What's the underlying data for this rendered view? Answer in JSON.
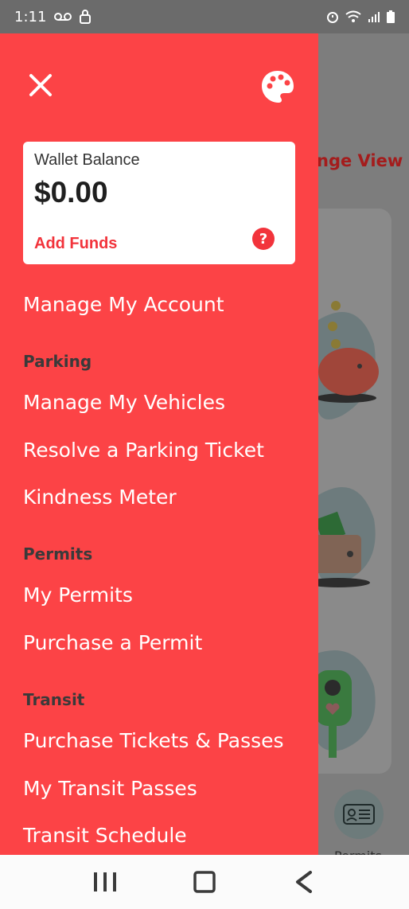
{
  "status_bar": {
    "time": "1:11",
    "icons_left": [
      "voicemail-icon",
      "lock-icon"
    ],
    "icons_right": [
      "alarm-icon",
      "wifi-icon",
      "signal-icon",
      "battery-icon"
    ]
  },
  "background": {
    "change_view_text": "nge View",
    "permits_label": "Permits"
  },
  "drawer": {
    "close_icon": "close-icon",
    "palette_icon": "palette-icon",
    "wallet": {
      "title": "Wallet Balance",
      "amount": "$0.00",
      "add_funds": "Add Funds",
      "help": "?"
    },
    "manage_account": "Manage My Account",
    "sections": [
      {
        "header": "Parking",
        "items": [
          "Manage My Vehicles",
          "Resolve a Parking Ticket",
          "Kindness Meter"
        ]
      },
      {
        "header": "Permits",
        "items": [
          "My Permits",
          "Purchase a Permit"
        ]
      },
      {
        "header": "Transit",
        "items": [
          "Purchase Tickets & Passes",
          "My Transit Passes",
          "Transit Schedule"
        ]
      }
    ]
  },
  "colors": {
    "drawer_bg": "#fc4346",
    "accent": "#f2333b",
    "section_header": "#3a3a3a",
    "scrim": "#7d7d7d"
  },
  "nav_bar": {
    "buttons": [
      "recent-apps-icon",
      "home-icon",
      "back-icon"
    ]
  }
}
